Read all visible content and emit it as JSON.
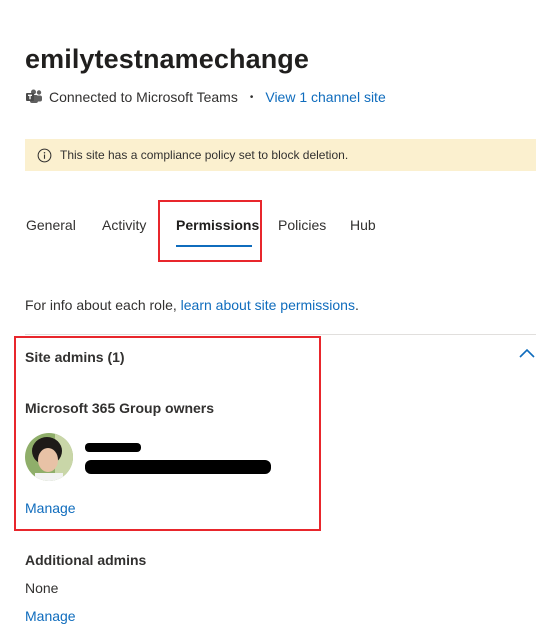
{
  "site": {
    "title": "emilytestnamechange",
    "connected_text": "Connected to Microsoft Teams",
    "separator": "•",
    "channel_link": "View 1 channel site"
  },
  "banner": {
    "text": "This site has a compliance policy set to block deletion."
  },
  "tabs": [
    {
      "label": "General"
    },
    {
      "label": "Activity"
    },
    {
      "label": "Permissions",
      "active": true
    },
    {
      "label": "Policies"
    },
    {
      "label": "Hub"
    }
  ],
  "info": {
    "prefix": "For info about each role, ",
    "link": "learn about site permissions",
    "suffix": "."
  },
  "site_admins": {
    "header": "Site admins (1)",
    "group_title": "Microsoft 365 Group owners",
    "manage": "Manage"
  },
  "additional_admins": {
    "header": "Additional admins",
    "value": "None",
    "manage": "Manage"
  },
  "icons": {
    "teams": "teams-icon",
    "info": "info-icon",
    "chevron": "chevron-up-icon",
    "avatar": "avatar"
  },
  "colors": {
    "link": "#0f6cbd",
    "banner": "#fbf0cf",
    "highlight": "#e8262c"
  }
}
